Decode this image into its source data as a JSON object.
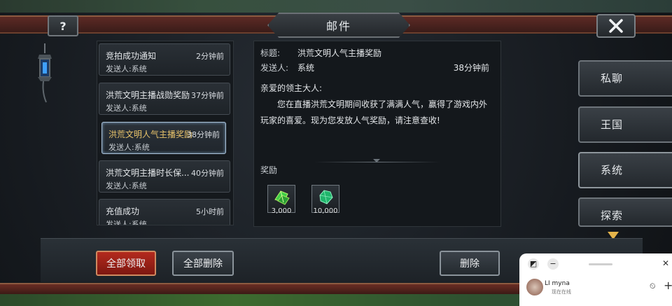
{
  "header": {
    "title": "邮件",
    "help_label": "?"
  },
  "mail_list": [
    {
      "subject": "竞拍成功通知",
      "time": "2分钟前",
      "sender": "发送人:系统",
      "selected": false
    },
    {
      "subject": "洪荒文明主播战勋奖励",
      "time": "37分钟前",
      "sender": "发送人:系统",
      "selected": false
    },
    {
      "subject": "洪荒文明人气主播奖励",
      "time": "38分钟前",
      "sender": "发送人:系统",
      "selected": true
    },
    {
      "subject": "洪荒文明主播时长保...",
      "time": "40分钟前",
      "sender": "发送人:系统",
      "selected": false
    },
    {
      "subject": "充值成功",
      "time": "5小时前",
      "sender": "发送人:系统",
      "selected": false
    }
  ],
  "detail": {
    "subject_label": "标题:",
    "subject": "洪荒文明人气主播奖励",
    "sender_label": "发送人:",
    "sender": "系统",
    "time": "38分钟前",
    "greeting": "亲爱的领主大人:",
    "body": "您在直播洪荒文明期间收获了满满人气，赢得了游戏内外玩家的喜爱。现为您发放人气奖励，请注意查收!",
    "rewards_label": "奖励",
    "rewards": [
      {
        "icon": "green-crystal-icon",
        "quantity": "3,000"
      },
      {
        "icon": "emerald-gem-icon",
        "quantity": "10,000"
      }
    ]
  },
  "tabs": [
    {
      "label": "私聊"
    },
    {
      "label": "王国"
    },
    {
      "label": "系统"
    },
    {
      "label": "探索"
    }
  ],
  "actions": {
    "claim_all": "全部领取",
    "delete_all": "全部删除",
    "delete": "删除"
  },
  "overlay": {
    "name": "LI myna",
    "status": "现在在线"
  },
  "colors": {
    "selected_subject": "#e8c36a",
    "claim_button": "#b42a1e",
    "scroll_arrow": "#e3b34a"
  }
}
